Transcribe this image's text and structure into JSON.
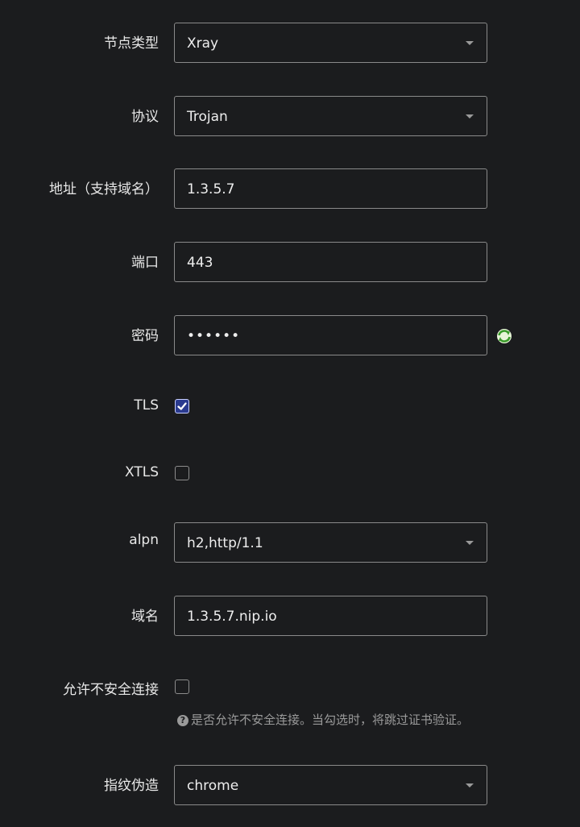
{
  "form": {
    "node_type": {
      "label": "节点类型",
      "value": "Xray"
    },
    "protocol": {
      "label": "协议",
      "value": "Trojan"
    },
    "address": {
      "label": "地址（支持域名）",
      "value": "1.3.5.7"
    },
    "port": {
      "label": "端口",
      "value": "443"
    },
    "password": {
      "label": "密码",
      "value": "••••••"
    },
    "tls": {
      "label": "TLS",
      "checked": true
    },
    "xtls": {
      "label": "XTLS",
      "checked": false
    },
    "alpn": {
      "label": "alpn",
      "value": "h2,http/1.1"
    },
    "domain": {
      "label": "域名",
      "value": "1.3.5.7.nip.io"
    },
    "allow_insecure": {
      "label": "允许不安全连接",
      "checked": false,
      "hint": "是否允许不安全连接。当勾选时，将跳过证书验证。"
    },
    "fingerprint": {
      "label": "指纹伪造",
      "value": "chrome"
    }
  },
  "colors": {
    "accent": "#2a3a8f",
    "background": "#1b1c1e"
  },
  "icons": {
    "refresh": "refresh-icon",
    "help": "question-circle-icon",
    "dropdown": "chevron-down-icon"
  }
}
